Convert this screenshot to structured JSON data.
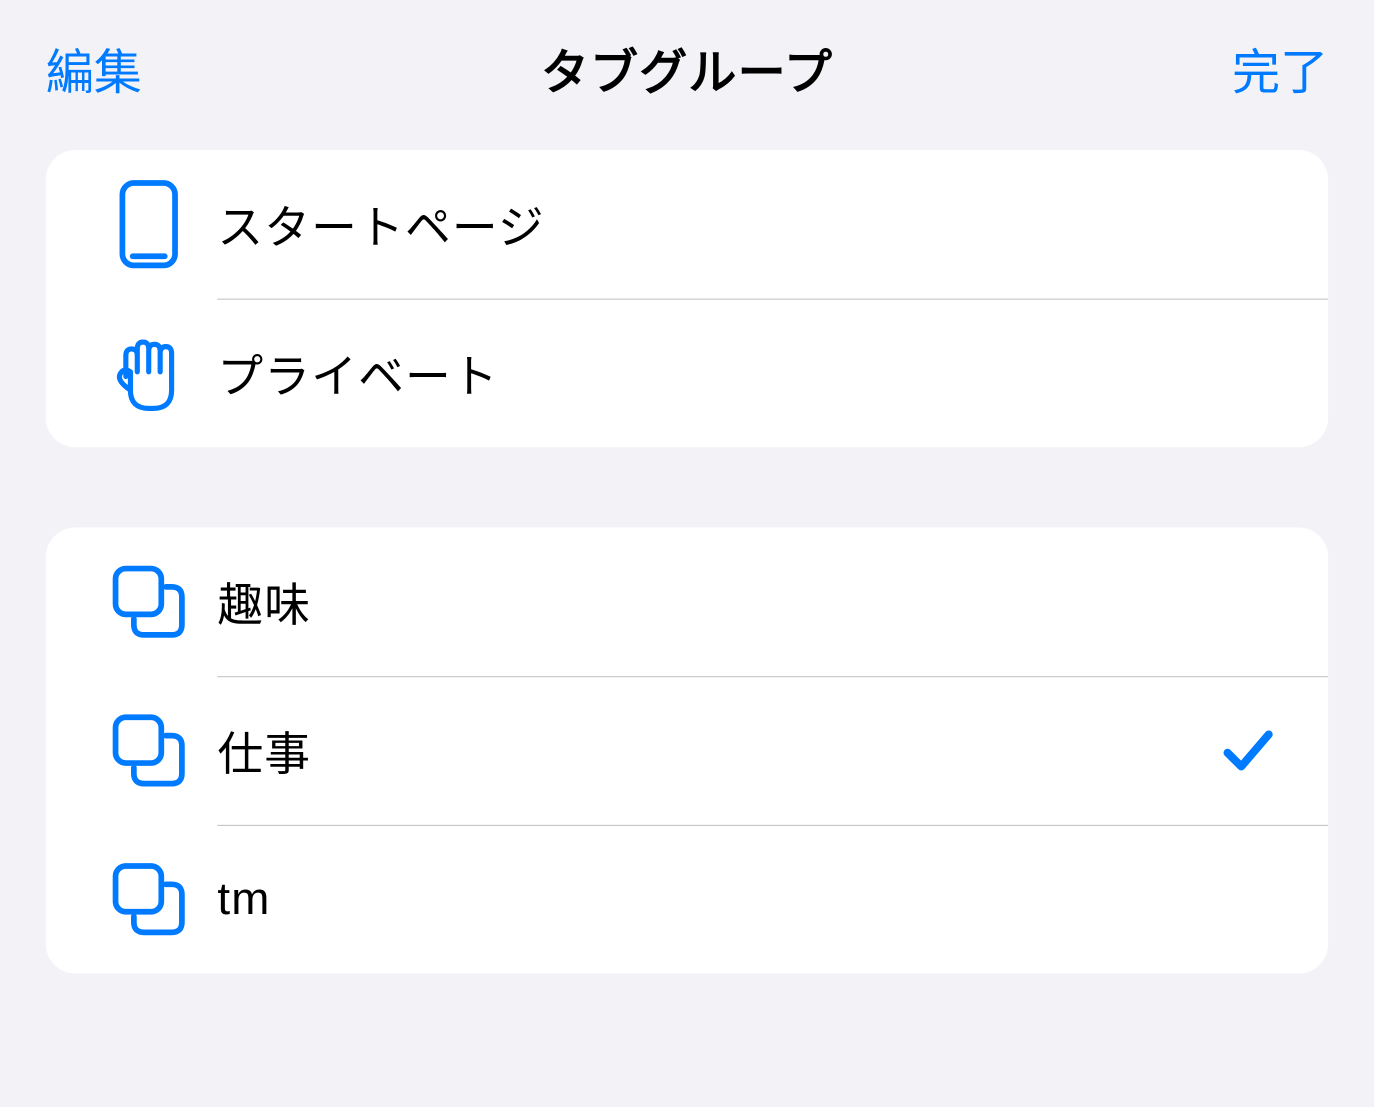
{
  "header": {
    "edit_label": "編集",
    "title": "タブグループ",
    "done_label": "完了"
  },
  "sections": [
    {
      "rows": [
        {
          "icon": "device",
          "label": "スタートページ",
          "selected": false
        },
        {
          "icon": "hand",
          "label": "プライベート",
          "selected": false
        }
      ]
    },
    {
      "rows": [
        {
          "icon": "group",
          "label": "趣味",
          "selected": false
        },
        {
          "icon": "group",
          "label": "仕事",
          "selected": true
        },
        {
          "icon": "group",
          "label": "tm",
          "selected": false
        }
      ]
    }
  ],
  "colors": {
    "accent": "#007aff"
  }
}
